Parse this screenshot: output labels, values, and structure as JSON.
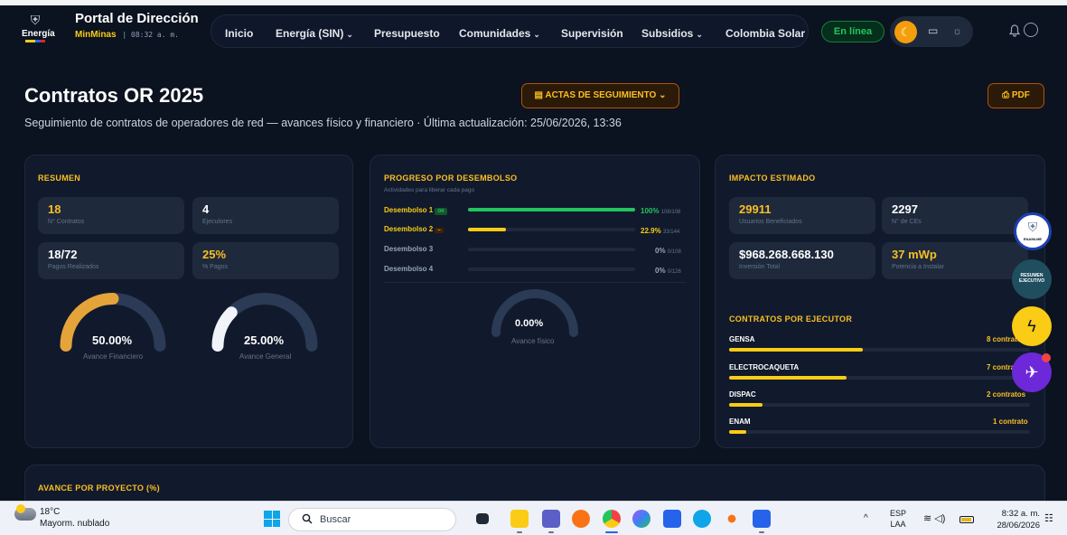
{
  "brand": {
    "word": "Energía",
    "shield": "⛨"
  },
  "portal": {
    "title": "Portal de Dirección",
    "org": "MinMinas",
    "sep": "|",
    "time": "08:32 a. m."
  },
  "nav": [
    {
      "label": "Inicio",
      "chevron": ""
    },
    {
      "label": "Energía (SIN)",
      "chevron": "⌄"
    },
    {
      "label": "Presupuesto",
      "chevron": ""
    },
    {
      "label": "Comunidades",
      "chevron": "⌄"
    },
    {
      "label": "Supervisión",
      "chevron": ""
    },
    {
      "label": "Subsidios",
      "chevron": "⌄"
    },
    {
      "label": "Colombia Solar",
      "chevron": ""
    }
  ],
  "status": {
    "online": "En línea"
  },
  "theme_icons": {
    "moon": "☾",
    "monitor": "▭",
    "sun": "☼",
    "bell": "🔔"
  },
  "page": {
    "title": "Contratos OR 2025",
    "subtitle": "Seguimiento de contratos de operadores de red — avances físico y financiero · Última actualización: 25/06/2026, 13:36",
    "actas_button": "▤  ACTAS DE SEGUIMIENTO  ⌄",
    "pdf_button": "⎙  PDF"
  },
  "resumen": {
    "title": "RESUMEN",
    "stats": [
      {
        "value": "18",
        "label": "N° Contratos",
        "color": "#fbbf24"
      },
      {
        "value": "4",
        "label": "Ejecutores",
        "color": "#ffffff"
      },
      {
        "value": "18/72",
        "label": "Pagos Realizados",
        "color": "#ffffff"
      },
      {
        "value": "25%",
        "label": "% Pagos",
        "color": "#fbbf24"
      }
    ],
    "gauges": [
      {
        "value": "50.00%",
        "label": "Avance Financiero",
        "fraction": 0.5,
        "color": "#e5a43a"
      },
      {
        "value": "25.00%",
        "label": "Avance General",
        "fraction": 0.25,
        "color": "#f1f5f9"
      }
    ]
  },
  "progreso": {
    "title": "PROGRESO POR DESEMBOLSO",
    "subtitle": "Actividades para liberar cada pago",
    "rows": [
      {
        "label": "Desembolso 1",
        "badge": "OK",
        "fraction": 1.0,
        "pct": "100%",
        "detail": "108/108",
        "color": "#22c55e"
      },
      {
        "label": "Desembolso 2",
        "badge": "–",
        "fraction": 0.229,
        "pct": "22.9%",
        "detail": "33/144",
        "color": "#facc15"
      },
      {
        "label": "Desembolso 3",
        "badge": "",
        "fraction": 0,
        "pct": "0%",
        "detail": "0/108",
        "color": "#94a3b8"
      },
      {
        "label": "Desembolso 4",
        "badge": "",
        "fraction": 0,
        "pct": "0%",
        "detail": "0/126",
        "color": "#94a3b8"
      }
    ],
    "gauge": {
      "value": "0.00%",
      "label": "Avance físico",
      "fraction": 0
    }
  },
  "impacto": {
    "title": "IMPACTO ESTIMADO",
    "stats": [
      {
        "value": "29911",
        "label": "Usuarios Beneficiados"
      },
      {
        "value": "2297",
        "label": "N° de CEs"
      },
      {
        "value": "$968.268.668.130",
        "label": "Inversión Total"
      },
      {
        "value": "37 mWp",
        "label": "Potencia a Instalar"
      }
    ],
    "ejecutores_title": "CONTRATOS POR EJECUTOR",
    "ejecutores": [
      {
        "name": "GENSA",
        "count": "8 contratos",
        "fraction": 0.444
      },
      {
        "name": "ELECTROCAQUETA",
        "count": "7 contratos",
        "fraction": 0.389
      },
      {
        "name": "DISPAC",
        "count": "2 contratos",
        "fraction": 0.111
      },
      {
        "name": "ENAM",
        "count": "1 contrato",
        "fraction": 0.056
      }
    ]
  },
  "avance": {
    "title": "AVANCE POR PROYECTO (%)"
  },
  "fabs": {
    "enaml_text": "ENAMLME",
    "resumen_text": "RESUMEN EJECUTIVO",
    "bolt": "ϟ",
    "assistant": "✈"
  },
  "taskbar": {
    "temp": "18°C",
    "weather": "Mayorm. nublado",
    "search": "Buscar",
    "lang1": "ESP",
    "lang2": "LAA",
    "time": "8:32 a. m.",
    "date": "28/06/2026"
  }
}
